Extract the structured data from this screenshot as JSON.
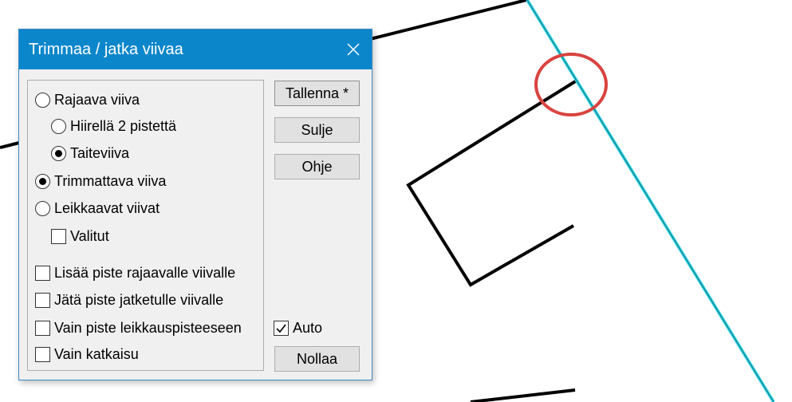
{
  "dialog": {
    "title": "Trimmaa / jatka viivaa",
    "close_icon": "close-icon",
    "options": {
      "rajaava_viiva": {
        "label": "Rajaava viiva",
        "checked": false
      },
      "hiirella_2_pistetta": {
        "label": "Hiirellä 2 pistettä",
        "checked": false
      },
      "taiteviiva": {
        "label": "Taiteviiva",
        "checked": true
      },
      "trimmattava_viiva": {
        "label": "Trimmattava viiva",
        "checked": true
      },
      "leikkaavat_viivat": {
        "label": "Leikkaavat viivat",
        "checked": false
      }
    },
    "checkboxes": {
      "valitut": {
        "label": "Valitut",
        "checked": false
      },
      "lisaa_piste": {
        "label": "Lisää piste rajaavalle viivalle",
        "checked": false
      },
      "jata_piste": {
        "label": "Jätä piste jatketulle viivalle",
        "checked": false
      },
      "vain_piste": {
        "label": "Vain piste leikkauspisteeseen",
        "checked": false
      },
      "vain_katkaisu": {
        "label": "Vain katkaisu",
        "checked": false
      },
      "auto": {
        "label": "Auto",
        "checked": true
      }
    },
    "buttons": {
      "tallenna": "Tallenna *",
      "sulje": "Sulje",
      "ohje": "Ohje",
      "nollaa": "Nollaa"
    }
  },
  "colors": {
    "titlebar": "#0b86ca",
    "highlight_line": "#33d6e6",
    "marker_circle": "#d9433f",
    "drawing_lines": "#000000"
  }
}
